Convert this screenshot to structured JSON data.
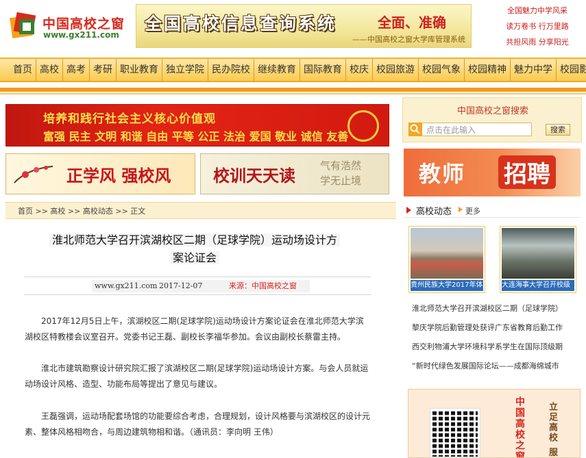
{
  "header": {
    "logo_cn": "中国高校之窗",
    "logo_url": "www.gx211.com",
    "banner_title": "全国高校信息查询系统",
    "banner_slogan": "全面、准确",
    "banner_sub": "——中国高校之窗大学库管理系统",
    "top_links": [
      "全国魅力中学风采",
      "读万卷书 行万里路",
      "共担风雨 分享阳光"
    ]
  },
  "nav": {
    "items": [
      "首页",
      "高校",
      "高考",
      "考研",
      "职业教育",
      "独立学院",
      "民办院校",
      "继续教育",
      "国际教育",
      "校庆",
      "校园旅游",
      "校园气象",
      "校园精神",
      "魅力中学",
      "校园影视"
    ]
  },
  "banners": {
    "values_line1": "培养和践行社会主义核心价值观",
    "values_line2": "富强 民主 文明 和谐 自由 平等 公正 法治 爱国 敬业 诚信 友善",
    "banner_a": "正学风 强校风",
    "banner_b": "校训天天读",
    "banner_b_callig1": "气有浩然",
    "banner_b_callig2": "学无止境"
  },
  "breadcrumb": {
    "text": "首页 >> 高校 >> 高校动态 >> 正文"
  },
  "article": {
    "title_line1": "淮北师范大学召开滨湖校区二期（足球学院）运动场设计方",
    "title_line2": "案论证会",
    "site": "www.gx211.com",
    "date": "2017-12-07",
    "source": "来源：中国高校之窗",
    "paragraphs": [
      "2017年12月5日上午，滨湖校区二期(足球学院)运动场设计方案论证会在淮北师范大学滨湖校区特教楼会议室召开。党委书记王磊、副校长李福华参加。会议由副校长蔡雷主持。",
      "淮北市建筑勘察设计研究院汇报了滨湖校区二期(足球学院)运动场设计方案。与会人员就运动场设计风格、造型、功能布局等提出了意见与建议。",
      "王磊强调，运动场配套场馆的功能要综合考虑，合理规划，设计风格要与滨湖校区的设计元素、整体风格相吻合，与周边建筑物相和谐。（通讯员：李向明 王伟）"
    ]
  },
  "sidebar": {
    "search_title": "中国高校之窗搜索",
    "search_placeholder": "点击在此输入",
    "search_button": "搜索",
    "recruit_1": "教师",
    "recruit_2": "招聘",
    "section_title": "高校动态",
    "more": "更多",
    "thumbs": [
      {
        "caption": "贵州民族大学2017年体"
      },
      {
        "caption": "大连海事大学召开校级"
      }
    ],
    "news": [
      "淮北师范大学召开滨湖校区二期（足球学院）",
      "黎庆学院后勤管理处获评广东省教育后勤工作",
      "西交利物浦大学环境科学系学生在国际顶级期",
      "“新时代绿色发展国际论坛——成都海绵城市"
    ],
    "qr_text1": "中国高校之窗",
    "qr_text2": "立足高校 服务"
  },
  "colors": {
    "brand_red": "#d8231c",
    "nav_orange": "#fbcb4f",
    "accent_orange": "#f39b1e",
    "thumb_caption_blue": "#2b6cb8"
  }
}
